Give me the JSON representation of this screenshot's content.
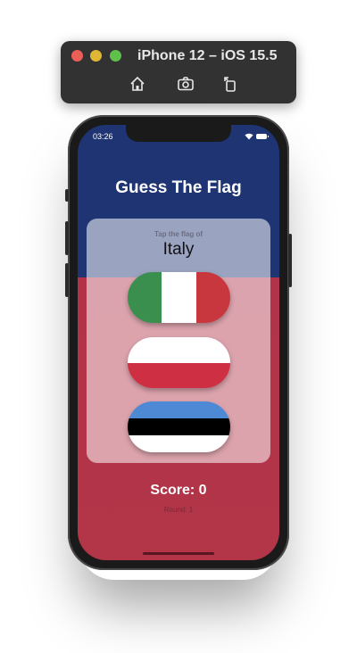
{
  "simulator": {
    "title": "iPhone 12 – iOS 15.5",
    "tools": [
      "home-icon",
      "screenshot-icon",
      "rotate-icon"
    ]
  },
  "status_bar": {
    "time": "03:26"
  },
  "game": {
    "title": "Guess The Flag",
    "prompt": "Tap the flag of",
    "country": "Italy",
    "score_label": "Score: 0",
    "round_label": "Round: 1",
    "flags": [
      "Italy",
      "Poland",
      "Estonia"
    ]
  },
  "colors": {
    "top_background": "#1f3472",
    "bottom_background": "#b0334a",
    "italy": [
      "#3b8f4e",
      "#ffffff",
      "#c9373e"
    ],
    "poland": [
      "#ffffff",
      "#cf2f42"
    ],
    "estonia": [
      "#4e89d6",
      "#000000",
      "#ffffff"
    ]
  }
}
